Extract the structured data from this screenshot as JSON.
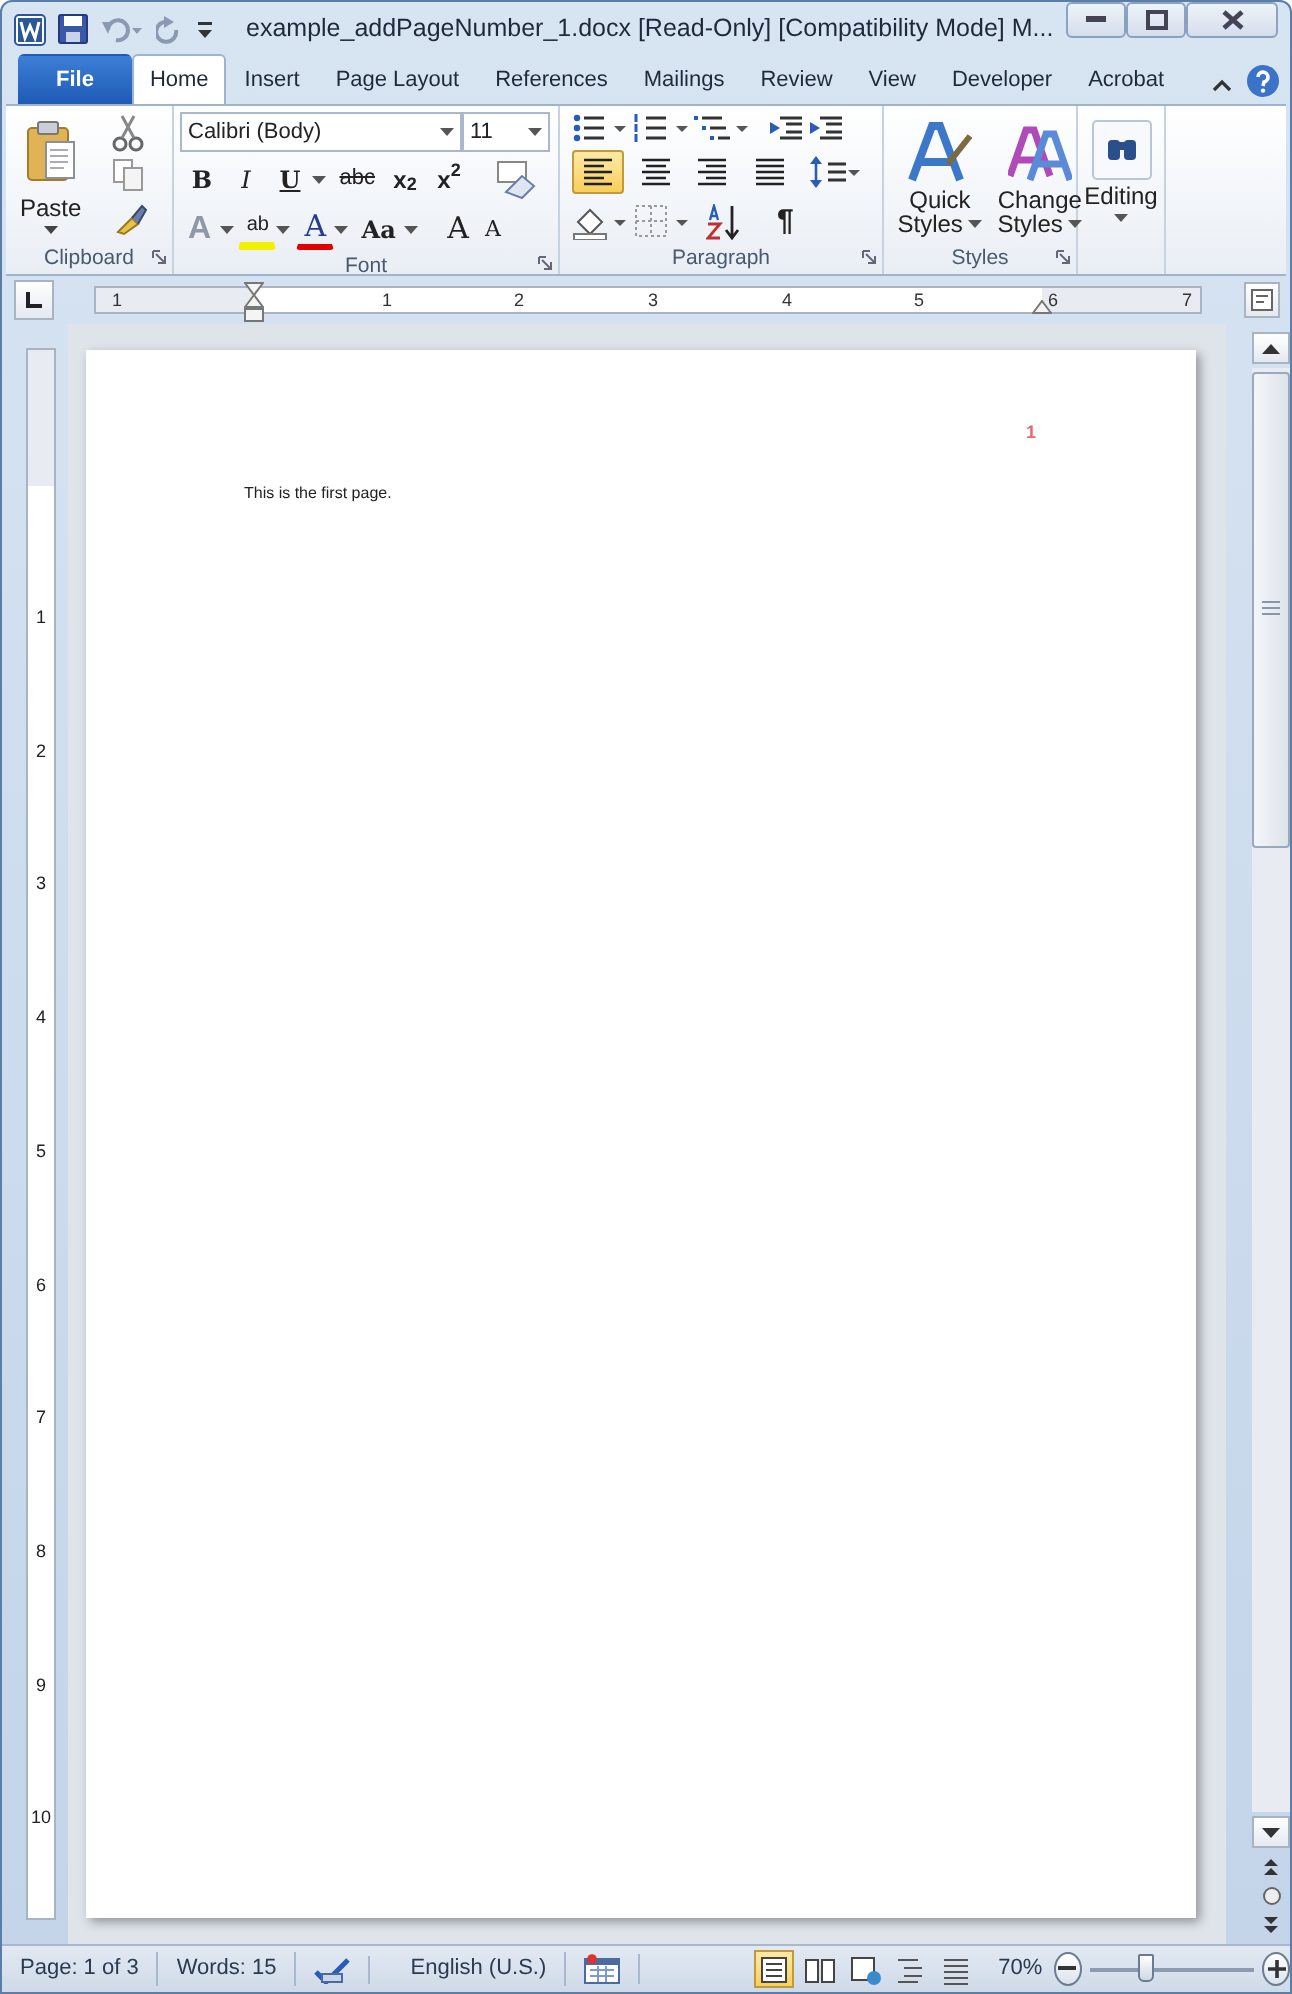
{
  "window": {
    "title": "example_addPageNumber_1.docx [Read-Only] [Compatibility Mode] M..."
  },
  "tabs": [
    {
      "label": "File",
      "kind": "file",
      "selected": false
    },
    {
      "label": "Home",
      "kind": "tab",
      "selected": true
    },
    {
      "label": "Insert",
      "kind": "tab",
      "selected": false
    },
    {
      "label": "Page Layout",
      "kind": "tab",
      "selected": false
    },
    {
      "label": "References",
      "kind": "tab",
      "selected": false
    },
    {
      "label": "Mailings",
      "kind": "tab",
      "selected": false
    },
    {
      "label": "Review",
      "kind": "tab",
      "selected": false
    },
    {
      "label": "View",
      "kind": "tab",
      "selected": false
    },
    {
      "label": "Developer",
      "kind": "tab",
      "selected": false
    },
    {
      "label": "Acrobat",
      "kind": "tab",
      "selected": false
    }
  ],
  "clipboard": {
    "paste_label": "Paste",
    "group_label": "Clipboard"
  },
  "font": {
    "font_name": "Calibri (Body)",
    "font_size": "11",
    "group_label": "Font",
    "format_buttons": [
      {
        "kind": "bold",
        "text": "B"
      },
      {
        "kind": "italic",
        "text": "I"
      },
      {
        "kind": "underline",
        "text": "U"
      },
      {
        "kind": "strike",
        "text": "abc"
      },
      {
        "kind": "sub",
        "text": "x$_{2}$"
      },
      {
        "kind": "sup",
        "text": "x$^{2}$"
      }
    ],
    "effect_buttons": [
      {
        "kind": "effects",
        "text": "A"
      },
      {
        "kind": "highlight",
        "text": "ab"
      },
      {
        "kind": "color",
        "text": "A"
      },
      {
        "kind": "case",
        "text": "Aa"
      },
      {
        "kind": "grow",
        "text": "A"
      },
      {
        "kind": "shrink",
        "text": "A"
      }
    ]
  },
  "paragraph": {
    "group_label": "Paragraph",
    "pilcrow": "¶",
    "alignment": [
      {
        "kind": "left",
        "selected": true
      },
      {
        "kind": "center",
        "selected": false
      },
      {
        "kind": "right",
        "selected": false
      },
      {
        "kind": "justify",
        "selected": false
      }
    ]
  },
  "styles": {
    "group_label": "Styles",
    "buttons": [
      {
        "line1": "Quick",
        "line2": "Styles"
      },
      {
        "line1": "Change",
        "line2": "Styles"
      }
    ]
  },
  "editing": {
    "label": "Editing"
  },
  "ruler": {
    "horizontal": [
      "1",
      "1",
      "2",
      "3",
      "4",
      "5",
      "6",
      "7"
    ],
    "vertical": [
      "1",
      "2",
      "3",
      "4",
      "5",
      "6",
      "7",
      "8",
      "9",
      "10"
    ]
  },
  "document": {
    "header_page_number": "1",
    "body": "This is the first page."
  },
  "status_bar": {
    "page": "Page: 1 of 3",
    "words": "Words: 15",
    "language": "English (U.S.)",
    "zoom": "70%",
    "zoom_slider": {
      "level": 0.35
    },
    "views": [
      {
        "kind": "print",
        "selected": true
      },
      {
        "kind": "reading",
        "selected": false
      },
      {
        "kind": "web",
        "selected": false
      },
      {
        "kind": "outline",
        "selected": false
      },
      {
        "kind": "draft",
        "selected": false
      }
    ]
  }
}
